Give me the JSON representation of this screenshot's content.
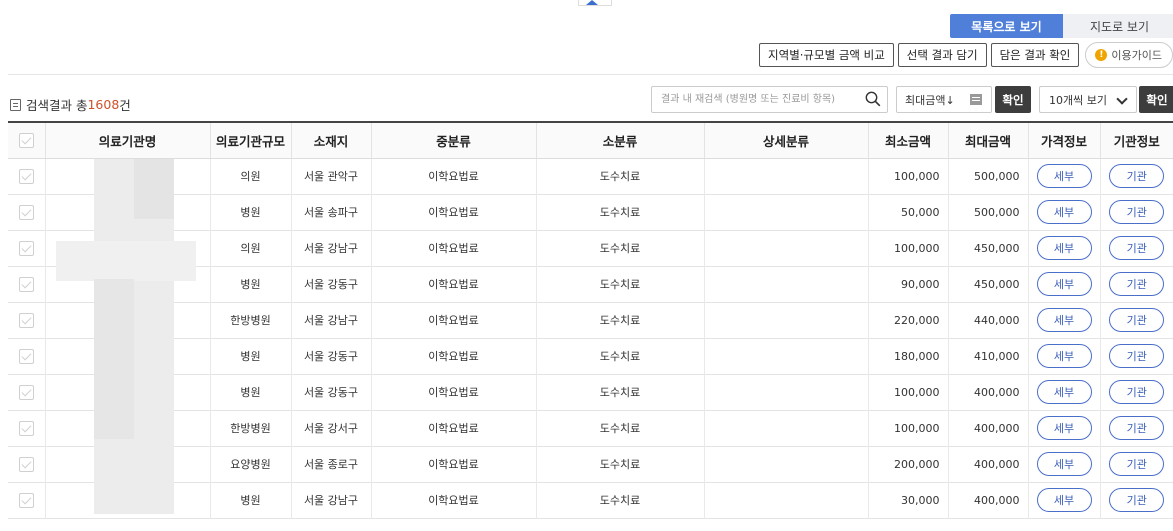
{
  "view_toggle": {
    "list_label": "목록으로 보기",
    "map_label": "지도로 보기"
  },
  "actions": {
    "compare_label": "지역별·규모별 금액 비교",
    "select_save_label": "선택 결과 담기",
    "check_saved_label": "담은 결과 확인",
    "guide_label": "이용가이드"
  },
  "summary": {
    "prefix": "검색결과 총",
    "count": "1608",
    "suffix": "건"
  },
  "search": {
    "placeholder": "결과 내 재검색 (병원명 또는 진료비 항목)"
  },
  "sort": {
    "label": "최대금액↓"
  },
  "confirm_label": "확인",
  "page_size": {
    "label": "10개씩 보기"
  },
  "table": {
    "headers": [
      "",
      "의료기관명",
      "의료기관규모",
      "소재지",
      "중분류",
      "소분류",
      "상세분류",
      "최소금액",
      "최대금액",
      "가격정보",
      "기관정보"
    ],
    "detail_label": "세부",
    "org_label": "기관",
    "rows": [
      {
        "size": "의원",
        "location": "서울 관악구",
        "mid": "이학요법료",
        "sub": "도수치료",
        "detail": "",
        "min": "100,000",
        "max": "500,000"
      },
      {
        "size": "병원",
        "location": "서울 송파구",
        "mid": "이학요법료",
        "sub": "도수치료",
        "detail": "",
        "min": "50,000",
        "max": "500,000"
      },
      {
        "size": "의원",
        "location": "서울 강남구",
        "mid": "이학요법료",
        "sub": "도수치료",
        "detail": "",
        "min": "100,000",
        "max": "450,000"
      },
      {
        "size": "병원",
        "location": "서울 강동구",
        "mid": "이학요법료",
        "sub": "도수치료",
        "detail": "",
        "min": "90,000",
        "max": "450,000"
      },
      {
        "size": "한방병원",
        "location": "서울 강남구",
        "mid": "이학요법료",
        "sub": "도수치료",
        "detail": "",
        "min": "220,000",
        "max": "440,000"
      },
      {
        "size": "병원",
        "location": "서울 강동구",
        "mid": "이학요법료",
        "sub": "도수치료",
        "detail": "",
        "min": "180,000",
        "max": "410,000"
      },
      {
        "size": "병원",
        "location": "서울 강동구",
        "mid": "이학요법료",
        "sub": "도수치료",
        "detail": "",
        "min": "100,000",
        "max": "400,000"
      },
      {
        "size": "한방병원",
        "location": "서울 강서구",
        "mid": "이학요법료",
        "sub": "도수치료",
        "detail": "",
        "min": "100,000",
        "max": "400,000"
      },
      {
        "size": "요양병원",
        "location": "서울 종로구",
        "mid": "이학요법료",
        "sub": "도수치료",
        "detail": "",
        "min": "200,000",
        "max": "400,000"
      },
      {
        "size": "병원",
        "location": "서울 강남구",
        "mid": "이학요법료",
        "sub": "도수치료",
        "detail": "",
        "min": "30,000",
        "max": "400,000"
      }
    ]
  },
  "colors": {
    "accent": "#4f7fd9",
    "count": "#d0502a",
    "pill_border": "#4a6fc8",
    "dark_button": "#3d3d3d"
  }
}
